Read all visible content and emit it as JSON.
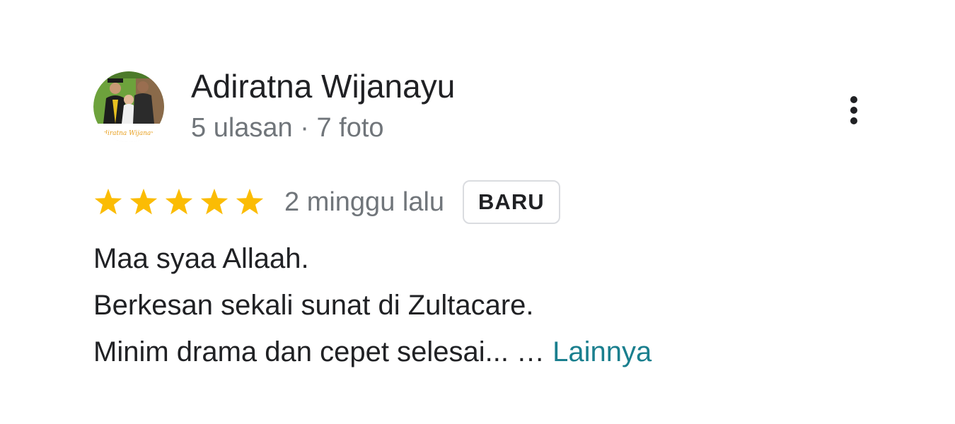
{
  "review": {
    "reviewer": {
      "name": "Adiratna Wijanayu",
      "meta": "5 ulasan · 7 foto",
      "avatar_caption": "Adiratna Wijanayu"
    },
    "rating": {
      "stars": 5,
      "max_stars": 5,
      "star_color": "#fbbc04"
    },
    "date": "2 minggu lalu",
    "badge": "BARU",
    "text_lines": [
      "Maa syaa Allaah.",
      "Berkesan sekali sunat di Zultacare.",
      "Minim drama dan cepet selesai... …"
    ],
    "more_link": "Lainnya",
    "link_color": "#1a7f8e",
    "more_menu_icon": "more-vert-icon"
  }
}
